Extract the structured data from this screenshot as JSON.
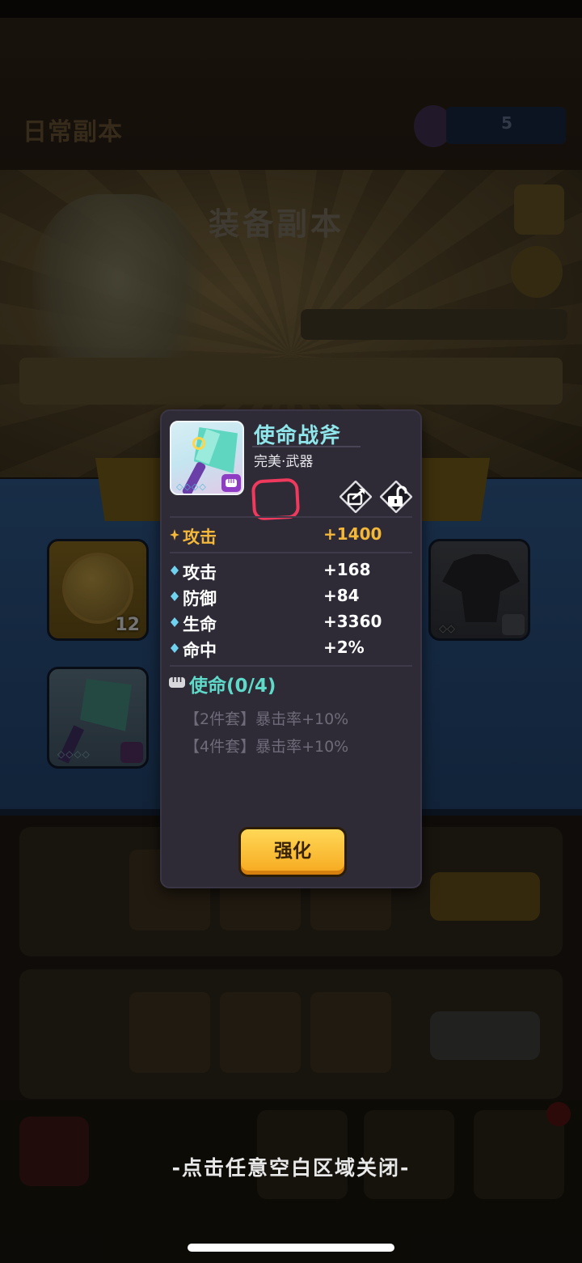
{
  "background": {
    "header_title": "日常副本",
    "banner_title": "装备副本",
    "currency_value": "5",
    "coin_slot_count": "12",
    "axe_slot_gems": "◇◇◇◇",
    "armor_slot_gems": "◇◇"
  },
  "popup": {
    "item_name": "使命战斧",
    "item_subtitle": "完美·武器",
    "item_gems": "◇◇◇◇",
    "main_stat": {
      "label": "攻击",
      "value": "+1400"
    },
    "stats": [
      {
        "label": "攻击",
        "value": "+168"
      },
      {
        "label": "防御",
        "value": "+84"
      },
      {
        "label": "生命",
        "value": "+3360"
      },
      {
        "label": "命中",
        "value": "+2%"
      }
    ],
    "set": {
      "title": "使命(0/4)",
      "bonuses": [
        "【2件套】暴击率+10%",
        "【4件套】暴击率+10%"
      ]
    },
    "upgrade_label": "强化"
  },
  "close_hint": "-点击任意空白区域关闭-",
  "colors": {
    "item_name": "#8fe6ea",
    "main_stat": "#f3b73a",
    "set_title": "#5fd9c8",
    "annotation_red": "#ef3a5d",
    "button_gold": "#f6a81e"
  },
  "icons": {
    "share": "share-icon",
    "lock": "unlock-icon",
    "fist": "fist-icon"
  }
}
